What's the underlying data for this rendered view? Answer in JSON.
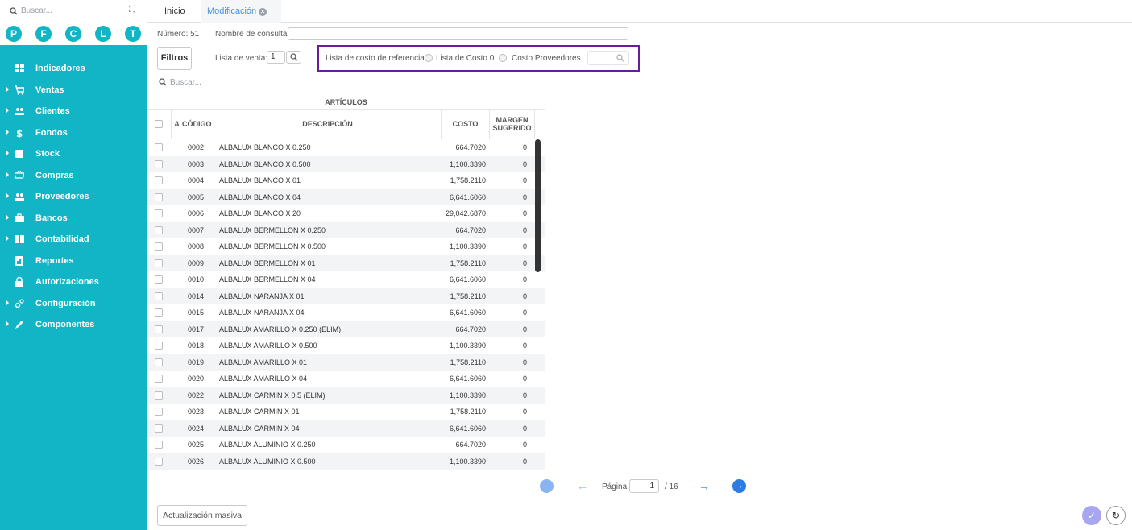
{
  "sidebar": {
    "search_placeholder": "Buscar...",
    "circles": [
      "P",
      "F",
      "C",
      "L",
      "T"
    ],
    "items": [
      {
        "label": "Indicadores",
        "icon": "grid-icon",
        "caret": false
      },
      {
        "label": "Ventas",
        "icon": "cart-icon",
        "caret": true
      },
      {
        "label": "Clientes",
        "icon": "people-icon",
        "caret": true
      },
      {
        "label": "Fondos",
        "icon": "dollar-icon",
        "caret": true
      },
      {
        "label": "Stock",
        "icon": "box-icon",
        "caret": true
      },
      {
        "label": "Compras",
        "icon": "basket-icon",
        "caret": true
      },
      {
        "label": "Proveedores",
        "icon": "people-icon",
        "caret": true
      },
      {
        "label": "Bancos",
        "icon": "briefcase-icon",
        "caret": true
      },
      {
        "label": "Contabilidad",
        "icon": "book-icon",
        "caret": true
      },
      {
        "label": "Reportes",
        "icon": "chart-icon",
        "caret": false
      },
      {
        "label": "Autorizaciones",
        "icon": "lock-icon",
        "caret": false
      },
      {
        "label": "Configuración",
        "icon": "gears-icon",
        "caret": true
      },
      {
        "label": "Componentes",
        "icon": "pencil-icon",
        "caret": true
      }
    ]
  },
  "tabs": {
    "inicio": "Inicio",
    "modificacion": "Modificación"
  },
  "form": {
    "numero_label": "Número: 51",
    "nombre_label": "Nombre de consulta:",
    "nombre_value": "",
    "filtros_label": "Filtros",
    "lista_venta_label": "Lista de venta:",
    "lista_venta_value": "1",
    "ref_label": "Lista de costo de referencia:",
    "ref_option1": "Lista de Costo 0",
    "ref_option2": "Costo Proveedores",
    "search_placeholder": "Buscar..."
  },
  "table": {
    "title": "ARTÍCULOS",
    "headers": {
      "a": "A",
      "codigo": "CÓDIGO",
      "descripcion": "DESCRIPCIÓN",
      "costo": "COSTO",
      "margen1": "MARGEN",
      "margen2": "SUGERIDO"
    },
    "rows": [
      {
        "codigo": "0002",
        "descripcion": "ALBALUX BLANCO X 0.250",
        "costo": "664.7020",
        "margen": "0"
      },
      {
        "codigo": "0003",
        "descripcion": "ALBALUX BLANCO X 0.500",
        "costo": "1,100.3390",
        "margen": "0"
      },
      {
        "codigo": "0004",
        "descripcion": "ALBALUX BLANCO X 01",
        "costo": "1,758.2110",
        "margen": "0"
      },
      {
        "codigo": "0005",
        "descripcion": "ALBALUX BLANCO X 04",
        "costo": "6,641.6060",
        "margen": "0"
      },
      {
        "codigo": "0006",
        "descripcion": "ALBALUX BLANCO X 20",
        "costo": "29,042.6870",
        "margen": "0"
      },
      {
        "codigo": "0007",
        "descripcion": "ALBALUX BERMELLON X 0.250",
        "costo": "664.7020",
        "margen": "0"
      },
      {
        "codigo": "0008",
        "descripcion": "ALBALUX BERMELLON X 0.500",
        "costo": "1,100.3390",
        "margen": "0"
      },
      {
        "codigo": "0009",
        "descripcion": "ALBALUX BERMELLON X 01",
        "costo": "1,758.2110",
        "margen": "0"
      },
      {
        "codigo": "0010",
        "descripcion": "ALBALUX BERMELLON X 04",
        "costo": "6,641.6060",
        "margen": "0"
      },
      {
        "codigo": "0014",
        "descripcion": "ALBALUX NARANJA X 01",
        "costo": "1,758.2110",
        "margen": "0"
      },
      {
        "codigo": "0015",
        "descripcion": "ALBALUX NARANJA X 04",
        "costo": "6,641.6060",
        "margen": "0"
      },
      {
        "codigo": "0017",
        "descripcion": "ALBALUX AMARILLO X 0.250 (ELIM)",
        "costo": "664.7020",
        "margen": "0"
      },
      {
        "codigo": "0018",
        "descripcion": "ALBALUX AMARILLO X 0.500",
        "costo": "1,100.3390",
        "margen": "0"
      },
      {
        "codigo": "0019",
        "descripcion": "ALBALUX AMARILLO X 01",
        "costo": "1,758.2110",
        "margen": "0"
      },
      {
        "codigo": "0020",
        "descripcion": "ALBALUX AMARILLO X 04",
        "costo": "6,641.6060",
        "margen": "0"
      },
      {
        "codigo": "0022",
        "descripcion": "ALBALUX CARMIN X 0.5 (ELIM)",
        "costo": "1,100.3390",
        "margen": "0"
      },
      {
        "codigo": "0023",
        "descripcion": "ALBALUX CARMIN X 01",
        "costo": "1,758.2110",
        "margen": "0"
      },
      {
        "codigo": "0024",
        "descripcion": "ALBALUX CARMIN X 04",
        "costo": "6,641.6060",
        "margen": "0"
      },
      {
        "codigo": "0025",
        "descripcion": "ALBALUX ALUMINIO X 0.250",
        "costo": "664.7020",
        "margen": "0"
      },
      {
        "codigo": "0026",
        "descripcion": "ALBALUX ALUMINIO X 0.500",
        "costo": "1,100.3390",
        "margen": "0"
      }
    ]
  },
  "pager": {
    "label": "Página",
    "page": "1",
    "total": "/ 16"
  },
  "bottom": {
    "masiva_label": "Actualización masiva"
  },
  "colors": {
    "accent": "#12b5c5",
    "link": "#4a90e2",
    "highlight_border": "#6a1b9a"
  }
}
